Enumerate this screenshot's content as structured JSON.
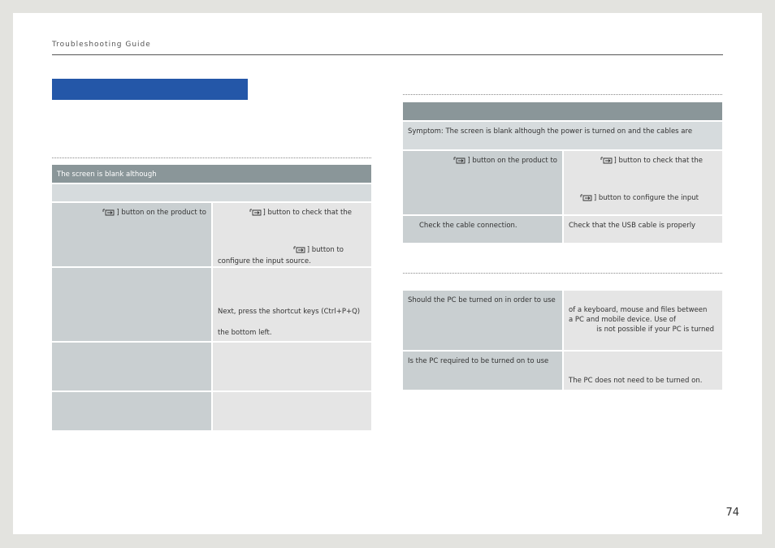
{
  "header": {
    "title": "Troubleshooting Guide"
  },
  "left_table": {
    "header_row": "The screen is blank although",
    "rows": [
      {
        "col1": "] button on the product to",
        "col2_line1": "] button to check that the",
        "col2_line2": "] button to",
        "col2_line3": "configure the input source."
      },
      {
        "col1": "",
        "col2_line1": "Next, press the shortcut keys (Ctrl+P+Q)",
        "col2_line2": "the bottom left."
      },
      {
        "col1": "",
        "col2": ""
      },
      {
        "col1": "",
        "col2": ""
      }
    ]
  },
  "right_table1": {
    "symptom": "Symptom: The screen is blank although the power is turned on and the cables are",
    "rows": [
      {
        "col1": "] button on the product to",
        "col2_line1": "] button to check that the",
        "col2_line2": "] button to configure the input"
      },
      {
        "col1": "Check the cable connection.",
        "col2": "Check that the USB cable is properly"
      }
    ]
  },
  "right_table2": {
    "rows": [
      {
        "col1": "Should the PC be turned on in order to use",
        "col2_line1": "of a keyboard, mouse and files between",
        "col2_line2": "a PC and mobile device. Use of",
        "col2_line3": "is not possible if your PC is turned"
      },
      {
        "col1": "Is the PC required to be turned on to use",
        "col2": "The PC does not need to be turned on."
      }
    ]
  },
  "icons": {
    "source": "source-icon"
  },
  "colors": {
    "accent_blue": "#2457a8",
    "table_header": "#8a9699"
  },
  "page_number": "74"
}
